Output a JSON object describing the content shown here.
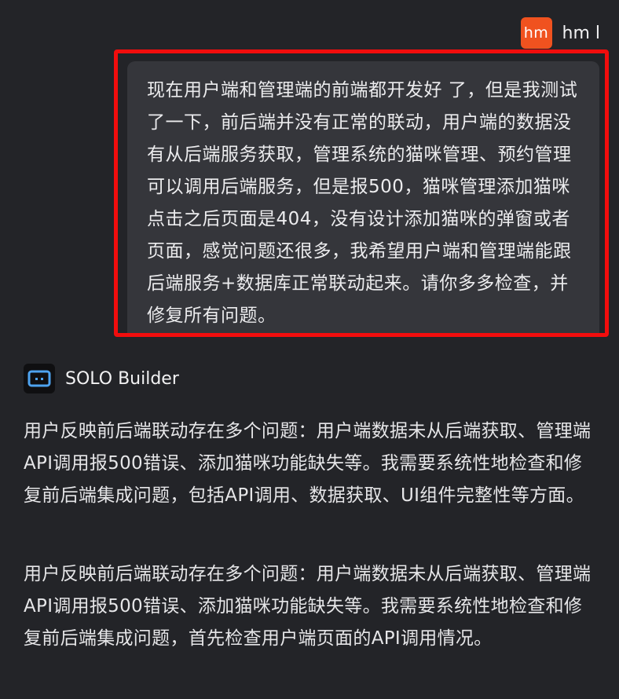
{
  "user": {
    "avatar_text": "hm",
    "name": "hm l",
    "avatar_color": "#f0521f",
    "message": "现在用户端和管理端的前端都开发好 了，但是我测试了一下，前后端并没有正常的联动，用户端的数据没有从后端服务获取，管理系统的猫咪管理、预约管理可以调用后端服务，但是报500，猫咪管理添加猫咪点击之后页面是404，没有设计添加猫咪的弹窗或者页面，感觉问题还很多，我希望用户端和管理端能跟后端服务+数据库正常联动起来。请你多多检查，并修复所有问题。"
  },
  "highlight_color": "#f20d0d",
  "bot": {
    "name": "SOLO Builder",
    "logo_icon": "robot-face-icon",
    "logo_accent": "#4ea3f0",
    "paragraphs": [
      "用户反映前后端联动存在多个问题：用户端数据未从后端获取、管理端API调用报500错误、添加猫咪功能缺失等。我需要系统性地检查和修复前后端集成问题，包括API调用、数据获取、UI组件完整性等方面。",
      "用户反映前后端联动存在多个问题：用户端数据未从后端获取、管理端API调用报500错误、添加猫咪功能缺失等。我需要系统性地检查和修复前后端集成问题，首先检查用户端页面的API调用情况。"
    ]
  }
}
